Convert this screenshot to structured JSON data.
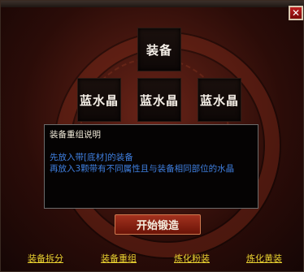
{
  "panel": {
    "close_label": "✕",
    "equip_slot_label": "装备",
    "crystal_slots": [
      "蓝水晶",
      "蓝水晶",
      "蓝水晶"
    ],
    "description": {
      "title": "装备重组说明",
      "lines": [
        "先放入带[底材]的装备",
        "再放入3颗带有不同属性且与装备相同部位的水晶"
      ]
    },
    "forge_button": "开始锻造",
    "bottom_links": [
      "装备拆分",
      "装备重组",
      "炼化粉装",
      "炼化黄装"
    ]
  },
  "colors": {
    "link": "#e8d030",
    "desc_text": "#3f7fe0",
    "close": "#c02020"
  }
}
